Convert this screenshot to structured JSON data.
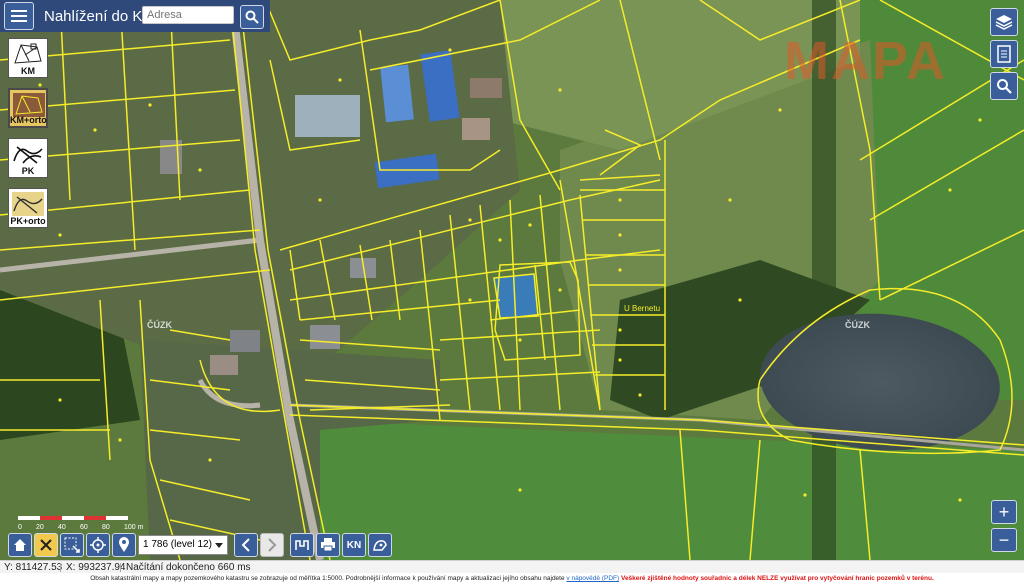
{
  "header": {
    "title": "Nahlížení do KN",
    "search_placeholder": "Adresa"
  },
  "layers": [
    {
      "label": "KM",
      "active": false
    },
    {
      "label": "KM+orto",
      "active": true
    },
    {
      "label": "PK",
      "active": false
    },
    {
      "label": "PK+orto",
      "active": false
    }
  ],
  "map": {
    "watermark": "MAPA",
    "labels": {
      "cuzk_1": "ČÚZK",
      "cuzk_2": "ČÚZK",
      "street": "U Bernetu"
    },
    "colors": {
      "parcel_lines": "#f5ec2a",
      "selected_parcel": "#2d7de0"
    }
  },
  "scale_bar": {
    "ticks": [
      "0",
      "20",
      "40",
      "60",
      "80",
      "100 m"
    ]
  },
  "toolbar": {
    "scale_value": "1 786 (level 12)",
    "kn_label": "KN"
  },
  "status": {
    "y_coord": "Y: 811427.53",
    "x_coord": "X: 993237.94",
    "load_status": "Načítání dokončeno 660 ms"
  },
  "footer": {
    "text": "Obsah katastrální mapy a mapy pozemkového katastru se zobrazuje od měřítka 1:5000. Podrobnější informace k používání mapy a aktualizaci jejího obsahu najdete",
    "link": "v nápovědě (PDF)",
    "warning": "Veškeré zjištěné hodnoty souřadnic a délek NELZE využívat pro vytyčování hranic pozemků v terénu."
  }
}
